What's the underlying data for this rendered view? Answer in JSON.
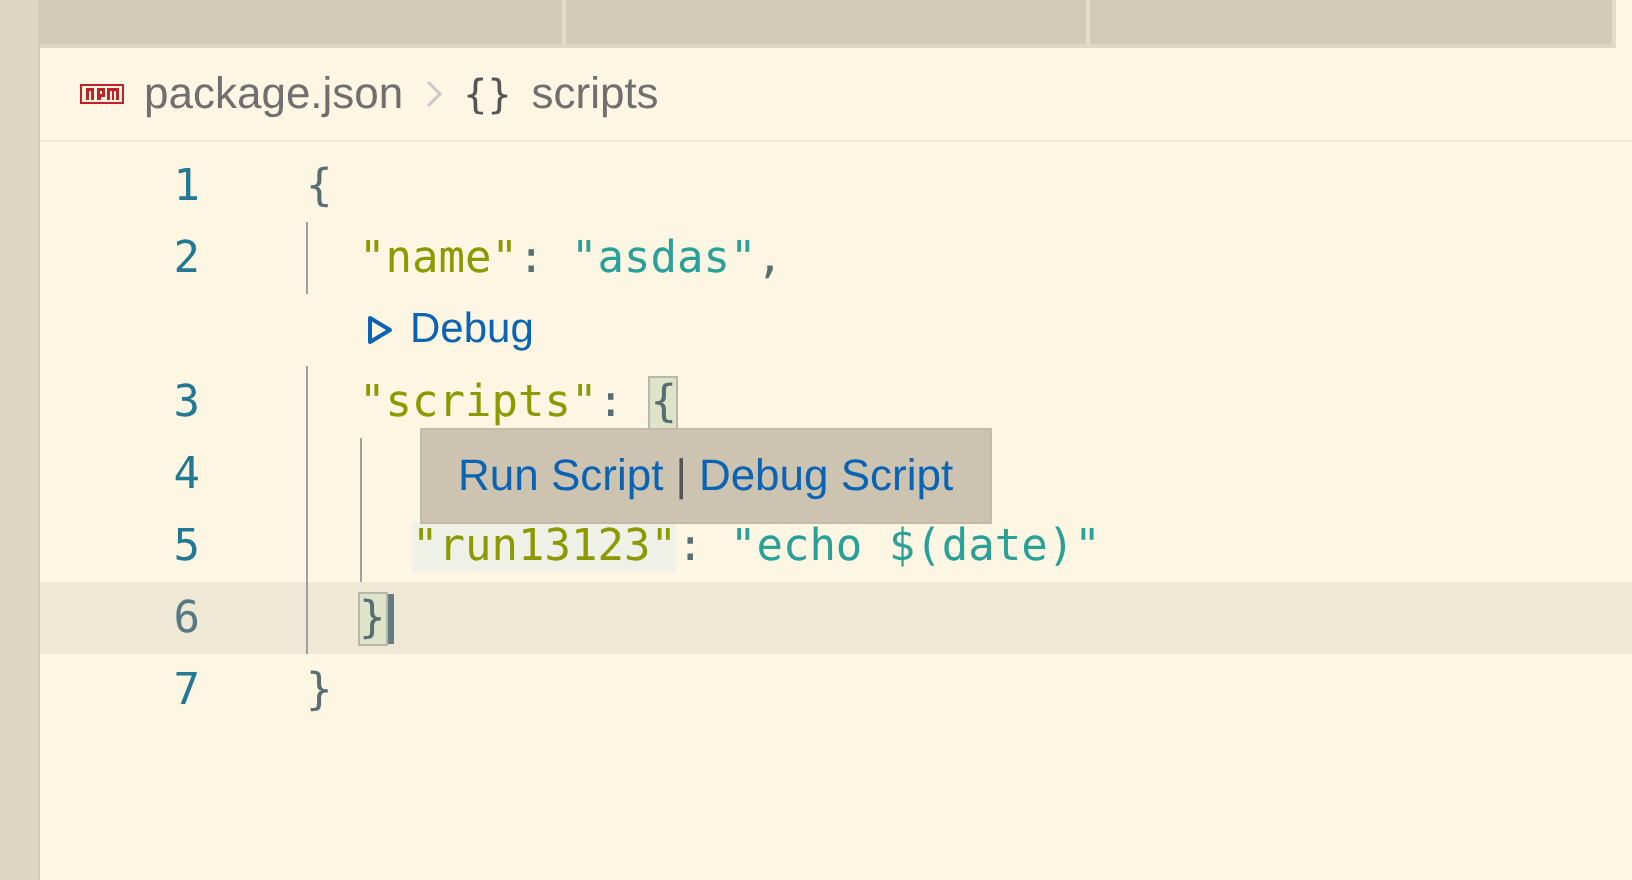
{
  "tabs": [
    {
      "selected": false
    },
    {
      "selected": false
    },
    {
      "selected": false
    }
  ],
  "breadcrumb": {
    "file": "package.json",
    "symbol": "{}",
    "section": "scripts"
  },
  "lines": [
    {
      "number": "1",
      "active": false,
      "tokens": [
        {
          "kind": "punct",
          "text": "{"
        }
      ],
      "children": [
        {
          "number": "2",
          "active": false,
          "tokens": [
            {
              "kind": "key",
              "text": "\"name\""
            },
            {
              "kind": "punct",
              "text": ": "
            },
            {
              "kind": "string",
              "text": "\"asdas\""
            },
            {
              "kind": "punct",
              "text": ","
            }
          ],
          "codelens": "Debug"
        },
        {
          "number": "3",
          "active": false,
          "tokens": [
            {
              "kind": "key",
              "text": "\"scripts\""
            },
            {
              "kind": "punct",
              "text": ": "
            },
            {
              "kind": "punct",
              "text": "{",
              "bracket_match": true
            }
          ],
          "children": [
            {
              "number": "4",
              "active": false
            },
            {
              "number": "5",
              "active": false,
              "tokens": [
                {
                  "kind": "key",
                  "text": "\"run13123\"",
                  "highlighted": true
                },
                {
                  "kind": "punct",
                  "text": ": "
                },
                {
                  "kind": "string",
                  "text": "\"echo $(date)\""
                }
              ]
            }
          ]
        },
        {
          "number": "6",
          "active": true,
          "tokens": [
            {
              "kind": "punct",
              "text": "}",
              "bracket_match": true,
              "cursor": true
            }
          ]
        }
      ]
    },
    {
      "number": "7",
      "active": false,
      "tokens": [
        {
          "kind": "punct",
          "text": "}"
        }
      ]
    }
  ],
  "hover": {
    "actions": [
      "Run Script",
      "Debug Script"
    ],
    "separator": "|"
  }
}
